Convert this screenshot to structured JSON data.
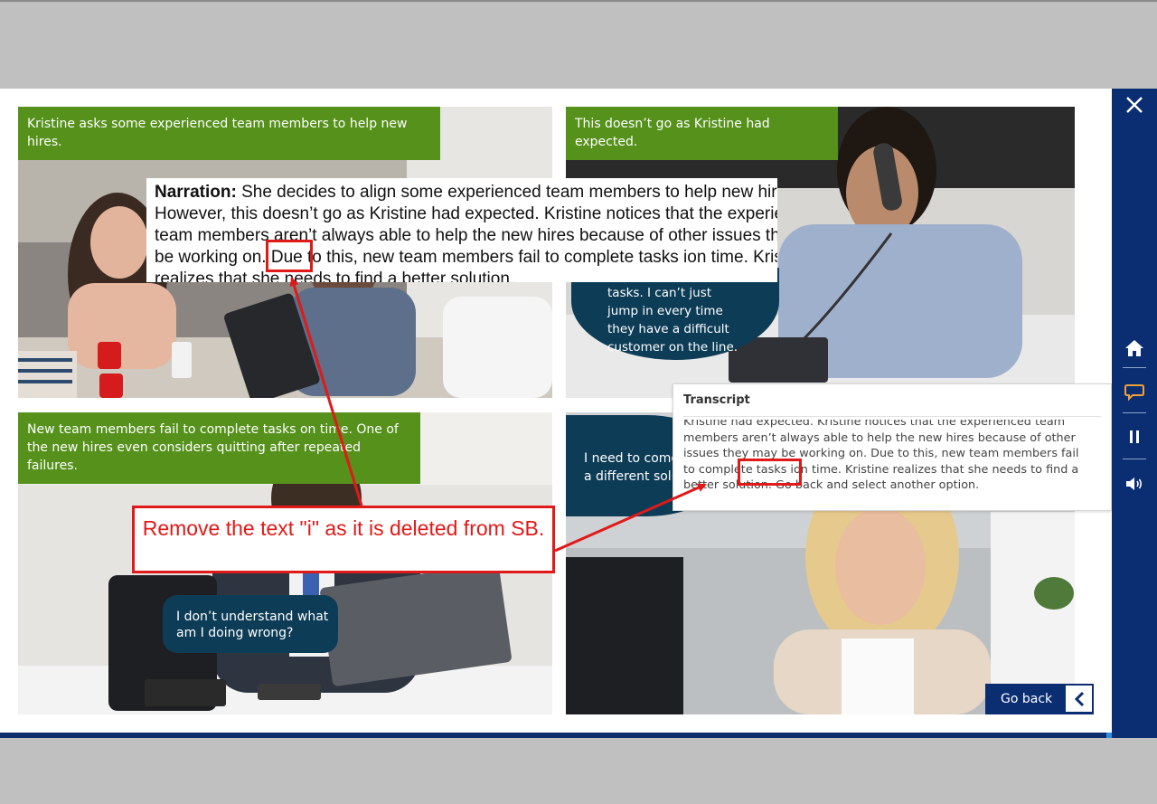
{
  "panels": [
    {
      "caption": "Kristine asks some experienced team members to help new hires."
    },
    {
      "caption": "This doesn’t go as Kristine had expected.",
      "bubble_lines": [
        "tasks. I can’t just",
        "jump in every time",
        "they have a difficult",
        "customer on the line."
      ]
    },
    {
      "caption": "New team members fail to complete tasks on time. One of the new hires even considers quitting after repeated failures.",
      "bubble_lines": [
        "I don’t understand what",
        "am I doing wrong?"
      ]
    },
    {
      "bubble_lines": [
        "I need to come",
        "a different solu"
      ]
    }
  ],
  "narration": {
    "label": "Narration:",
    "text": " She decides to align some experienced team members to help new hires. However, this doesn’t go as Kristine had expected. Kristine notices that the experienced team members aren’t always able to help the new hires because of other issues they may be working on. Due to this, new team members fail to complete tasks ion time. Kristine realizes that she needs to find a better solution."
  },
  "transcript": {
    "title": "Transcript",
    "text": "Kristine had expected. Kristine notices that the experienced team members aren’t always able to help the new hires because of other issues they may be working on. Due to this, new team members fail to complete tasks ion time. Kristine realizes that she needs to find a better solution. Go back and select another option."
  },
  "go_back": {
    "label": "Go back"
  },
  "annotation": {
    "text": "Remove the text \"i\" as it is deleted from SB.",
    "color": "#e01919"
  },
  "sidebar": {
    "icons": [
      "close-icon",
      "home-icon",
      "transcript-icon",
      "pause-icon",
      "volume-icon"
    ],
    "active_color": "#f0a33a"
  },
  "colors": {
    "caption_bg": "#55911b",
    "bubble_bg": "#0d3c57",
    "nav_bg": "#0b2e73"
  }
}
